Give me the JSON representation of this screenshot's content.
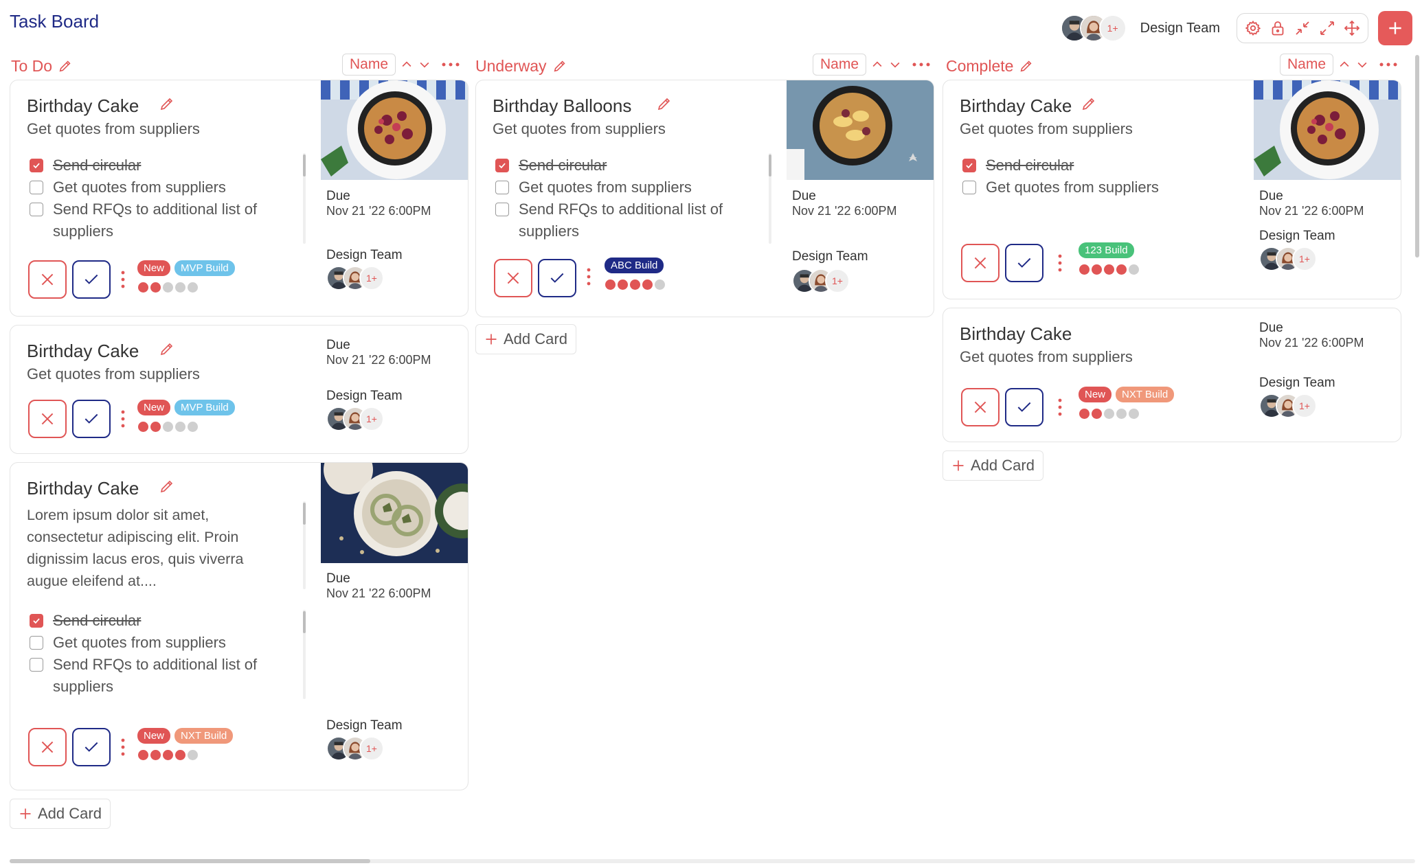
{
  "app": {
    "title": "Task Board"
  },
  "header": {
    "team_label": "Design Team",
    "avatar_more": "1+",
    "tools": [
      "gear-icon",
      "lock-icon",
      "collapse-icon",
      "expand-icon",
      "move-icon"
    ],
    "add_icon": "plus-icon"
  },
  "colors": {
    "accent": "#e05555",
    "navy": "#1f2a86",
    "tag_new": "#e05555",
    "tag_mvp": "#6ec3ea",
    "tag_nxt": "#f0987a",
    "tag_abc": "#1f2a86",
    "tag_123": "#49c27a"
  },
  "columns": [
    {
      "title": "To Do",
      "sort_label": "Name",
      "add_card_label": "Add Card"
    },
    {
      "title": "Underway",
      "sort_label": "Name",
      "add_card_label": "Add Card"
    },
    {
      "title": "Complete",
      "sort_label": "Name",
      "add_card_label": "Add Card"
    }
  ],
  "cards": {
    "todo1": {
      "title": "Birthday Cake",
      "subtitle": "Get quotes from suppliers",
      "checklist": [
        {
          "text": "Send circular",
          "done": true
        },
        {
          "text": "Get quotes from suppliers",
          "done": false
        },
        {
          "text": "Send RFQs to additional list of suppliers",
          "done": false
        }
      ],
      "due_label": "Due",
      "due_value": "Nov 21 '22 6:00PM",
      "team_label": "Design Team",
      "avatar_more": "1+",
      "tags": [
        "New",
        "MVP Build"
      ],
      "progress_filled": 2,
      "progress_total": 5
    },
    "todo2": {
      "title": "Birthday Cake",
      "subtitle": "Get quotes from suppliers",
      "due_label": "Due",
      "due_value": "Nov 21 '22 6:00PM",
      "team_label": "Design Team",
      "avatar_more": "1+",
      "tags": [
        "New",
        "MVP Build"
      ],
      "progress_filled": 2,
      "progress_total": 5
    },
    "todo3": {
      "title": "Birthday Cake",
      "description": "Lorem ipsum dolor sit amet, consectetur adipiscing elit. Proin dignissim lacus eros, quis viverra augue eleifend at....",
      "checklist": [
        {
          "text": "Send circular",
          "done": true
        },
        {
          "text": "Get quotes from suppliers",
          "done": false
        },
        {
          "text": "Send RFQs to additional list of suppliers",
          "done": false
        }
      ],
      "due_label": "Due",
      "due_value": "Nov 21 '22 6:00PM",
      "team_label": "Design Team",
      "avatar_more": "1+",
      "tags": [
        "New",
        "NXT Build"
      ],
      "progress_filled": 4,
      "progress_total": 5
    },
    "under1": {
      "title": "Birthday Balloons",
      "subtitle": "Get quotes from suppliers",
      "checklist": [
        {
          "text": "Send circular",
          "done": true
        },
        {
          "text": "Get quotes from suppliers",
          "done": false
        },
        {
          "text": "Send RFQs to additional list of suppliers",
          "done": false
        }
      ],
      "due_label": "Due",
      "due_value": "Nov 21 '22 6:00PM",
      "team_label": "Design Team",
      "avatar_more": "1+",
      "tags": [
        "ABC Build"
      ],
      "progress_filled": 4,
      "progress_total": 5
    },
    "comp1": {
      "title": "Birthday Cake",
      "subtitle": "Get quotes from suppliers",
      "checklist": [
        {
          "text": "Send circular",
          "done": true
        },
        {
          "text": "Get quotes from suppliers",
          "done": false
        }
      ],
      "due_label": "Due",
      "due_value": "Nov 21 '22 6:00PM",
      "team_label": "Design Team",
      "avatar_more": "1+",
      "tags": [
        "123 Build"
      ],
      "progress_filled": 4,
      "progress_total": 5
    },
    "comp2": {
      "title": "Birthday Cake",
      "subtitle": "Get quotes from suppliers",
      "due_label": "Due",
      "due_value": "Nov 21 '22 6:00PM",
      "team_label": "Design Team",
      "avatar_more": "1+",
      "tags": [
        "New",
        "NXT Build"
      ],
      "progress_filled": 2,
      "progress_total": 5
    }
  }
}
